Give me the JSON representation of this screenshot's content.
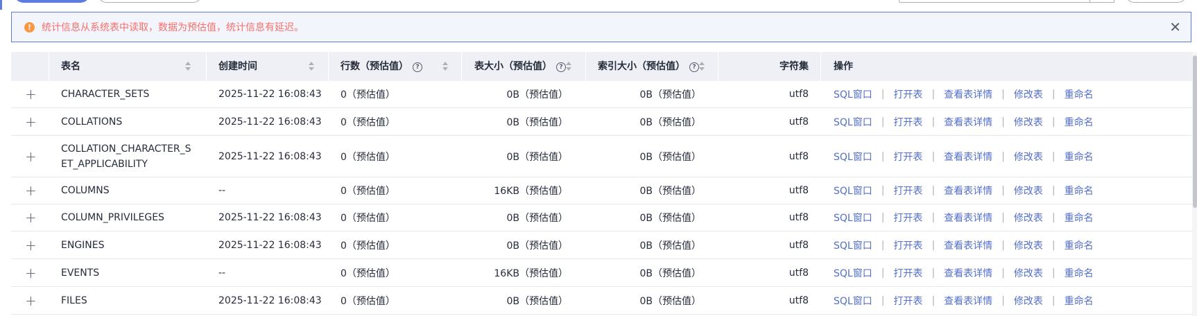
{
  "alert": {
    "message": "统计信息从系统表中读取，数据为预估值，统计信息有延迟。",
    "icon": "warning-icon",
    "icon_color": "#fa9841",
    "text_color": "#f66f6a"
  },
  "table": {
    "headers": {
      "name": "表名",
      "created": "创建时间",
      "rows": "行数（预估值）",
      "size": "表大小（预估值）",
      "index_size": "索引大小（预估值）",
      "charset": "字符集",
      "actions": "操作"
    },
    "action_labels": [
      "SQL窗口",
      "打开表",
      "查看表详情",
      "修改表",
      "重命名"
    ],
    "divider": "|",
    "expand_symbol": "+",
    "rows": [
      {
        "name": "CHARACTER_SETS",
        "created": "2025-11-22 16:08:43",
        "rows": "0（预估值）",
        "size": "0B（预估值）",
        "index_size": "0B（预估值）",
        "charset": "utf8"
      },
      {
        "name": "COLLATIONS",
        "created": "2025-11-22 16:08:43",
        "rows": "0（预估值）",
        "size": "0B（预估值）",
        "index_size": "0B（预估值）",
        "charset": "utf8"
      },
      {
        "name": "COLLATION_CHARACTER_SET_APPLICABILITY",
        "name_line1": "COLLATION_CHARACTER_S",
        "name_line2": "ET_APPLICABILITY",
        "created": "2025-11-22 16:08:43",
        "rows": "0（预估值）",
        "size": "0B（预估值）",
        "index_size": "0B（预估值）",
        "charset": "utf8"
      },
      {
        "name": "COLUMNS",
        "created": "--",
        "rows": "0（预估值）",
        "size": "16KB（预估值）",
        "index_size": "0B（预估值）",
        "charset": "utf8"
      },
      {
        "name": "COLUMN_PRIVILEGES",
        "created": "2025-11-22 16:08:43",
        "rows": "0（预估值）",
        "size": "0B（预估值）",
        "index_size": "0B（预估值）",
        "charset": "utf8"
      },
      {
        "name": "ENGINES",
        "created": "2025-11-22 16:08:43",
        "rows": "0（预估值）",
        "size": "0B（预估值）",
        "index_size": "0B（预估值）",
        "charset": "utf8"
      },
      {
        "name": "EVENTS",
        "created": "--",
        "rows": "0（预估值）",
        "size": "16KB（预估值）",
        "index_size": "0B（预估值）",
        "charset": "utf8"
      },
      {
        "name": "FILES",
        "created": "2025-11-22 16:08:43",
        "rows": "0（预估值）",
        "size": "0B（预估值）",
        "index_size": "0B（预估值）",
        "charset": "utf8"
      }
    ]
  }
}
